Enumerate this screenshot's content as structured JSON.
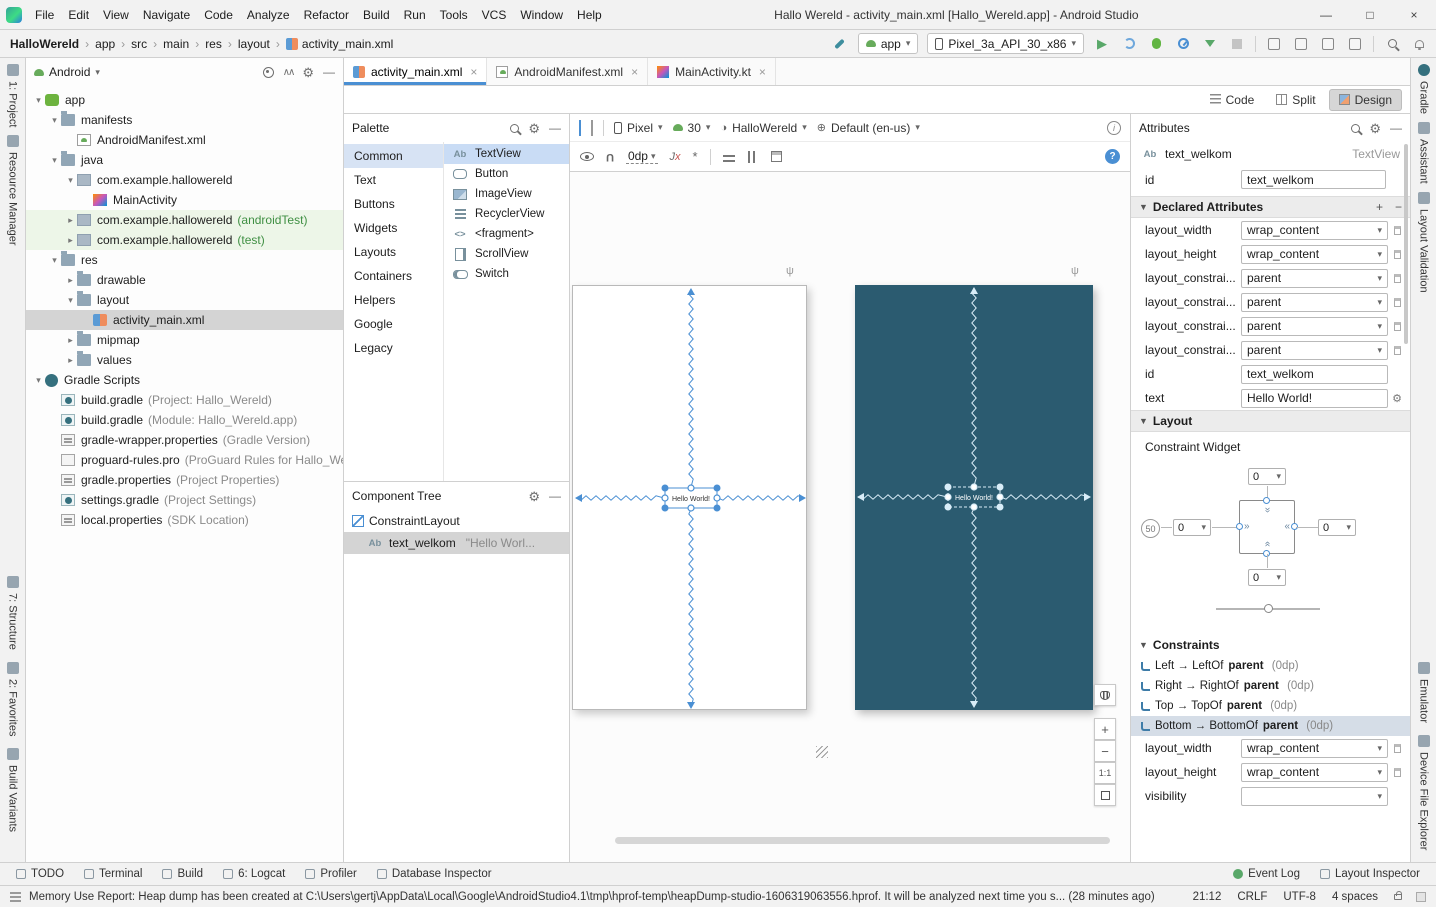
{
  "window": {
    "title": "Hallo Wereld - activity_main.xml [Hallo_Wereld.app] - Android Studio",
    "menus": [
      "File",
      "Edit",
      "View",
      "Navigate",
      "Code",
      "Analyze",
      "Refactor",
      "Build",
      "Run",
      "Tools",
      "VCS",
      "Window",
      "Help"
    ]
  },
  "toolbar": {
    "breadcrumbs": [
      "HalloWereld",
      "app",
      "src",
      "main",
      "res",
      "layout",
      "activity_main.xml"
    ],
    "run_config": "app",
    "device": "Pixel_3a_API_30_x86"
  },
  "left_strip": [
    "1: Project",
    "Resource Manager",
    "7: Structure",
    "2: Favorites",
    "Build Variants"
  ],
  "right_strip": [
    "Gradle",
    "Assistant",
    "Layout Validation",
    "Emulator",
    "Device File Explorer"
  ],
  "project": {
    "view_mode": "Android",
    "tree": [
      {
        "level": 0,
        "expand": "open",
        "icon": "app",
        "label": "app"
      },
      {
        "level": 1,
        "expand": "open",
        "icon": "folder",
        "label": "manifests"
      },
      {
        "level": 2,
        "expand": "none",
        "icon": "manifest",
        "label": "AndroidManifest.xml"
      },
      {
        "level": 1,
        "expand": "open",
        "icon": "folder",
        "label": "java"
      },
      {
        "level": 2,
        "expand": "open",
        "icon": "package",
        "label": "com.example.hallowereld"
      },
      {
        "level": 3,
        "expand": "none",
        "icon": "kotlin",
        "label": "MainActivity"
      },
      {
        "level": 2,
        "expand": "closed",
        "icon": "package",
        "label": "com.example.hallowereld",
        "annotation": "(androidTest)",
        "highlight": "green"
      },
      {
        "level": 2,
        "expand": "closed",
        "icon": "package",
        "label": "com.example.hallowereld",
        "annotation": "(test)",
        "highlight": "green"
      },
      {
        "level": 1,
        "expand": "open",
        "icon": "folder",
        "label": "res"
      },
      {
        "level": 2,
        "expand": "closed",
        "icon": "folder",
        "label": "drawable"
      },
      {
        "level": 2,
        "expand": "open",
        "icon": "folder",
        "label": "layout"
      },
      {
        "level": 3,
        "expand": "none",
        "icon": "layout-file",
        "label": "activity_main.xml",
        "selected": true
      },
      {
        "level": 2,
        "expand": "closed",
        "icon": "folder",
        "label": "mipmap"
      },
      {
        "level": 2,
        "expand": "closed",
        "icon": "folder",
        "label": "values"
      },
      {
        "level": 0,
        "expand": "open",
        "icon": "gradle",
        "label": "Gradle Scripts"
      },
      {
        "level": 1,
        "expand": "none",
        "icon": "gradle-file",
        "label": "build.gradle",
        "annotation": "(Project: Hallo_Wereld)"
      },
      {
        "level": 1,
        "expand": "none",
        "icon": "gradle-file",
        "label": "build.gradle",
        "annotation": "(Module: Hallo_Wereld.app)"
      },
      {
        "level": 1,
        "expand": "none",
        "icon": "properties",
        "label": "gradle-wrapper.properties",
        "annotation": "(Gradle Version)"
      },
      {
        "level": 1,
        "expand": "none",
        "icon": "proguard",
        "label": "proguard-rules.pro",
        "annotation": "(ProGuard Rules for Hallo_Wer"
      },
      {
        "level": 1,
        "expand": "none",
        "icon": "properties",
        "label": "gradle.properties",
        "annotation": "(Project Properties)"
      },
      {
        "level": 1,
        "expand": "none",
        "icon": "gradle-file",
        "label": "settings.gradle",
        "annotation": "(Project Settings)"
      },
      {
        "level": 1,
        "expand": "none",
        "icon": "properties",
        "label": "local.properties",
        "annotation": "(SDK Location)"
      }
    ]
  },
  "tabs": [
    {
      "label": "activity_main.xml",
      "icon": "layout-file",
      "active": true
    },
    {
      "label": "AndroidManifest.xml",
      "icon": "manifest",
      "active": false
    },
    {
      "label": "MainActivity.kt",
      "icon": "kotlin",
      "active": false
    }
  ],
  "mode_switch": [
    "Code",
    "Split",
    "Design"
  ],
  "palette": {
    "title": "Palette",
    "categories": [
      "Common",
      "Text",
      "Buttons",
      "Widgets",
      "Layouts",
      "Containers",
      "Helpers",
      "Google",
      "Legacy"
    ],
    "selected_category": "Common",
    "items": [
      {
        "icon": "textview",
        "label": "TextView",
        "selected": true
      },
      {
        "icon": "button",
        "label": "Button"
      },
      {
        "icon": "imageview",
        "label": "ImageView"
      },
      {
        "icon": "recyclerview",
        "label": "RecyclerView"
      },
      {
        "icon": "fragment",
        "label": "<fragment>"
      },
      {
        "icon": "scrollview",
        "label": "ScrollView"
      },
      {
        "icon": "switch",
        "label": "Switch"
      }
    ]
  },
  "component_tree": {
    "title": "Component Tree",
    "items": [
      {
        "icon": "constraintlayout",
        "label": "ConstraintLayout",
        "level": 0
      },
      {
        "icon": "textview",
        "label": "text_welkom",
        "annotation": "\"Hello Worl...",
        "level": 1,
        "selected": true
      }
    ]
  },
  "design_toolbar": {
    "device": "Pixel",
    "api": "30",
    "theme": "HalloWereld",
    "locale": "Default (en-us)",
    "margin": "0dp"
  },
  "canvas": {
    "preview_text": "Hello World!"
  },
  "attributes": {
    "title": "Attributes",
    "component_id": "text_welkom",
    "component_type": "TextView",
    "id_label": "id",
    "id_value": "text_welkom",
    "sections": {
      "declared": "Declared Attributes",
      "layout": "Layout",
      "constraint_widget": "Constraint Widget",
      "constraints": "Constraints"
    },
    "declared_rows": [
      {
        "name": "layout_width",
        "value": "wrap_content",
        "dropdown": true,
        "flag": true
      },
      {
        "name": "layout_height",
        "value": "wrap_content",
        "dropdown": true,
        "flag": true
      },
      {
        "name": "layout_constrai...",
        "value": "parent",
        "dropdown": true,
        "flag": true
      },
      {
        "name": "layout_constrai...",
        "value": "parent",
        "dropdown": true,
        "flag": true
      },
      {
        "name": "layout_constrai...",
        "value": "parent",
        "dropdown": true,
        "flag": true
      },
      {
        "name": "layout_constrai...",
        "value": "parent",
        "dropdown": true,
        "flag": true
      },
      {
        "name": "id",
        "value": "text_welkom",
        "dropdown": false,
        "flag": false
      },
      {
        "name": "text",
        "value": "Hello World!",
        "dropdown": false,
        "flag": false,
        "wrench": true
      }
    ],
    "widget": {
      "margin_top": "0",
      "margin_left": "0",
      "margin_right": "0",
      "margin_bottom": "0",
      "bias_vertical": "50",
      "bias_horizontal": "50"
    },
    "constraints": [
      {
        "label": "Left → LeftOf",
        "target": "parent",
        "extra": "(0dp)"
      },
      {
        "label": "Right → RightOf",
        "target": "parent",
        "extra": "(0dp)"
      },
      {
        "label": "Top → TopOf",
        "target": "parent",
        "extra": "(0dp)"
      },
      {
        "label": "Bottom → BottomOf",
        "target": "parent",
        "extra": "(0dp)",
        "selected": true
      }
    ],
    "bottom_rows": [
      {
        "name": "layout_width",
        "value": "wrap_content",
        "dropdown": true,
        "flag": true
      },
      {
        "name": "layout_height",
        "value": "wrap_content",
        "dropdown": true,
        "flag": true
      },
      {
        "name": "visibility",
        "value": "",
        "dropdown": true,
        "flag": false
      }
    ]
  },
  "bottom_bar": {
    "left": [
      "TODO",
      "Terminal",
      "Build",
      "6: Logcat",
      "Profiler",
      "Database Inspector"
    ],
    "right": [
      "Event Log",
      "Layout Inspector"
    ]
  },
  "status_bar": {
    "message": "Memory Use Report: Heap dump has been created at C:\\Users\\gertj\\AppData\\Local\\Google\\AndroidStudio4.1\\tmp\\hprof-temp\\heapDump-studio-1606319063556.hprof. It will be analyzed next time you s... (28 minutes ago)",
    "time": "21:12",
    "line_ending": "CRLF",
    "encoding": "UTF-8",
    "indent": "4 spaces"
  }
}
